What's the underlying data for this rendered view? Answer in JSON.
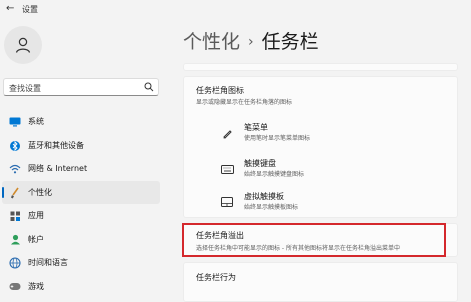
{
  "window": {
    "title": "设置"
  },
  "search": {
    "placeholder": "查找设置"
  },
  "nav": [
    {
      "label": "系统",
      "icon": "monitor-icon"
    },
    {
      "label": "蓝牙和其他设备",
      "icon": "bluetooth-icon"
    },
    {
      "label": "网络 & Internet",
      "icon": "wifi-icon"
    },
    {
      "label": "个性化",
      "icon": "brush-icon",
      "active": true
    },
    {
      "label": "应用",
      "icon": "apps-icon"
    },
    {
      "label": "帐户",
      "icon": "account-icon"
    },
    {
      "label": "时间和语言",
      "icon": "globe-clock-icon"
    },
    {
      "label": "游戏",
      "icon": "gamepad-icon"
    }
  ],
  "breadcrumb": {
    "parent": "个性化",
    "separator": "›",
    "current": "任务栏"
  },
  "corner_icons": {
    "title": "任务栏角图标",
    "description": "显示或隐藏显示在任务栏角落的图标",
    "items": [
      {
        "title": "笔菜单",
        "description": "使用笔时显示笔菜单图标",
        "icon": "pen-icon"
      },
      {
        "title": "触摸键盘",
        "description": "始终显示触摸键盘图标",
        "icon": "keyboard-icon"
      },
      {
        "title": "虚拟触摸板",
        "description": "始终显示触摸板图标",
        "icon": "touchpad-icon"
      }
    ]
  },
  "corner_overflow": {
    "title": "任务栏角溢出",
    "description": "选择任务栏角中可能显示的图标 - 所有其他图标将显示在任务栏角溢出菜单中"
  },
  "behaviors": {
    "title": "任务栏行为"
  },
  "colors": {
    "accent": "#0067c0",
    "highlight_border": "#d4282c"
  }
}
